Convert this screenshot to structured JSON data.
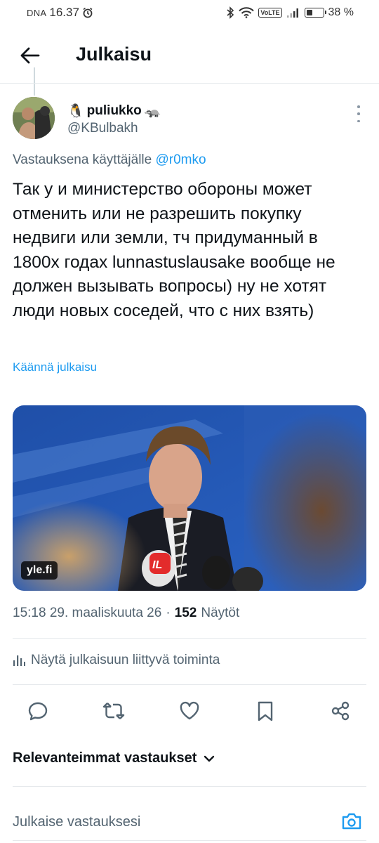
{
  "status_bar": {
    "carrier": "DNA",
    "time": "16.37",
    "battery": "38 %",
    "battery_level": 0.38,
    "network_badge": "VoLTE"
  },
  "header": {
    "title": "Julkaisu"
  },
  "post": {
    "author": {
      "name": "puliukko",
      "name_prefix_emoji": "🐧",
      "name_suffix_emoji": "🦡",
      "handle": "@KBulbakh"
    },
    "reply_prefix": "Vastauksena käyttäjälle",
    "reply_to_handle": "@r0mko",
    "text": "Так у и министерство обороны может отменить или не разрешить покупку недвиги или земли, тч придуманный в 1800х годах lunnastuslausake вообще не должен вызывать вопросы) ну не хотят люди новых соседей, что с них взять)",
    "translate_label": "Käännä julkaisu",
    "media": {
      "source_label": "yle.fi",
      "microphone_logo_text": "IL"
    },
    "timestamp": "15:18 29. maaliskuuta 26",
    "separator": "·",
    "views_count": "152",
    "views_label": "Näytöt",
    "activity_label": "Näytä julkaisuun liittyvä toiminta"
  },
  "actions": [
    {
      "name": "reply-icon"
    },
    {
      "name": "repost-icon"
    },
    {
      "name": "like-icon"
    },
    {
      "name": "bookmark-icon"
    },
    {
      "name": "share-icon"
    }
  ],
  "replies": {
    "sort_label": "Relevanteimmat vastaukset"
  },
  "composer": {
    "placeholder": "Julkaise vastauksesi"
  },
  "colors": {
    "accent": "#1d9bf0",
    "text_primary": "#0f1419",
    "text_secondary": "#536471",
    "divider": "#e6e9ec"
  }
}
